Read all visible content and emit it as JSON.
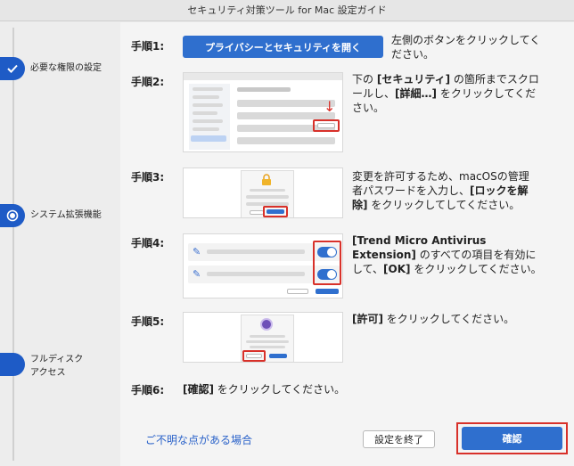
{
  "window": {
    "title": "セキュリティ対策ツール for Mac 設定ガイド"
  },
  "sidebar": {
    "steps": [
      {
        "label": "必要な権限の設定",
        "state": "done"
      },
      {
        "label": "システム拡張機能",
        "state": "current"
      },
      {
        "label": "フルディスクアクセス",
        "label_line1": "フルディスク",
        "label_line2": "アクセス",
        "state": "pending"
      }
    ]
  },
  "steps": {
    "s1": {
      "num": "手順1:",
      "button": "プライバシーとセキュリティを開く",
      "desc_line1": "左側のボタンをクリックしてく",
      "desc_line2": "ださい。"
    },
    "s2": {
      "num": "手順2:",
      "l1a": "下の ",
      "l1b": "[セキュリティ]",
      "l1c": " の箇所までスクロ",
      "l2a": "ールし、",
      "l2b": "[詳細…]",
      "l2c": " をクリックしてくだ",
      "l3": "さい。"
    },
    "s3": {
      "num": "手順3:",
      "l1": "変更を許可するため、macOSの管理",
      "l2a": "者パスワードを入力し、",
      "l2b": "[ロックを解",
      "l3a": "除]",
      "l3b": " をクリックしてしてください。"
    },
    "s4": {
      "num": "手順4:",
      "l1": "[Trend Micro Antivirus",
      "l2a": "Extension]",
      "l2b": " のすべての項目を有効に",
      "l3a": "して、",
      "l3b": "[OK]",
      "l3c": " をクリックしてください。"
    },
    "s5": {
      "num": "手順5:",
      "b": "[許可]",
      "rest": " をクリックしてください。"
    },
    "s6": {
      "num": "手順6:",
      "b": "[確認]",
      "rest": " をクリックしてください。"
    }
  },
  "footer": {
    "help_link": "ご不明な点がある場合",
    "end_button": "設定を終了",
    "confirm_button": "確認"
  },
  "colors": {
    "accent": "#2f6fce",
    "highlight": "#d8312a",
    "link": "#2a62c9"
  }
}
